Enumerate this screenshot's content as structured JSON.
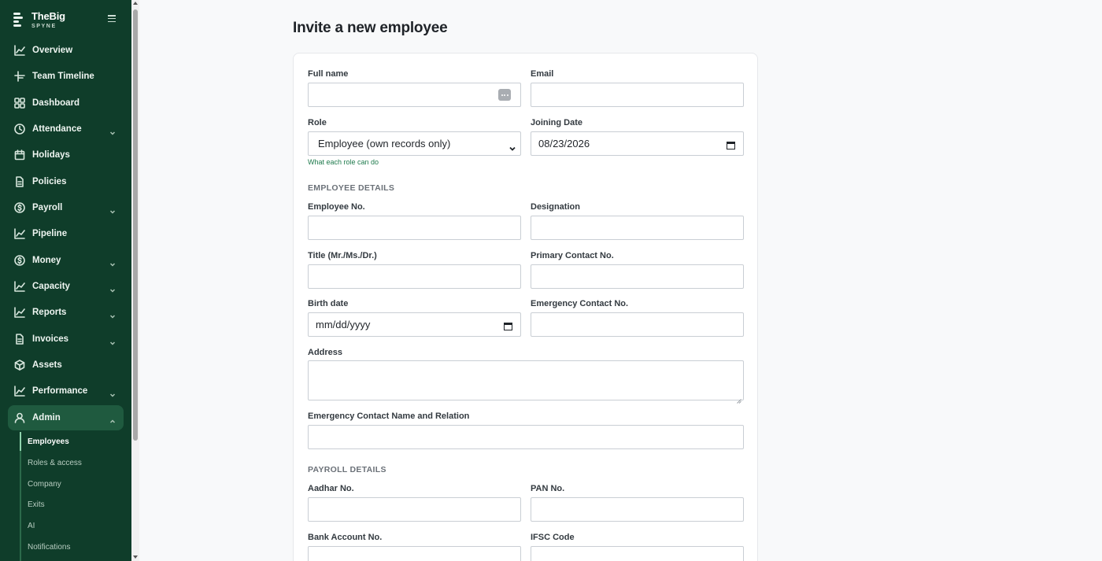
{
  "brand": {
    "name": "TheBig",
    "sub": "SPYNE"
  },
  "sidebar": {
    "items": [
      {
        "label": "Overview",
        "icon": "line-chart-icon",
        "has_chevron": false
      },
      {
        "label": "Team Timeline",
        "icon": "timeline-icon",
        "has_chevron": false
      },
      {
        "label": "Dashboard",
        "icon": "grid-icon",
        "has_chevron": false
      },
      {
        "label": "Attendance",
        "icon": "clock-icon",
        "has_chevron": true
      },
      {
        "label": "Holidays",
        "icon": "calendar-icon",
        "has_chevron": false
      },
      {
        "label": "Policies",
        "icon": "document-icon",
        "has_chevron": false
      },
      {
        "label": "Payroll",
        "icon": "dollar-circle-icon",
        "has_chevron": true
      },
      {
        "label": "Pipeline",
        "icon": "line-chart-icon",
        "has_chevron": false
      },
      {
        "label": "Money",
        "icon": "dollar-circle-icon",
        "has_chevron": true
      },
      {
        "label": "Capacity",
        "icon": "line-chart-icon",
        "has_chevron": true
      },
      {
        "label": "Reports",
        "icon": "line-chart-icon",
        "has_chevron": true
      },
      {
        "label": "Invoices",
        "icon": "document-icon",
        "has_chevron": true
      },
      {
        "label": "Assets",
        "icon": "box-icon",
        "has_chevron": false
      },
      {
        "label": "Performance",
        "icon": "line-chart-icon",
        "has_chevron": true
      },
      {
        "label": "Admin",
        "icon": "user-icon",
        "has_chevron": true,
        "active": true
      }
    ],
    "admin_subitems": [
      "Employees",
      "Roles & access",
      "Company",
      "Exits",
      "AI",
      "Notifications"
    ],
    "current_subitem": "Employees"
  },
  "page": {
    "title": "Invite a new employee"
  },
  "form": {
    "full_name_label": "Full name",
    "full_name_value": "",
    "email_label": "Email",
    "email_value": "",
    "role_label": "Role",
    "role_value": "Employee (own records only)",
    "role_help": "What each role can do",
    "joining_date_label": "Joining Date",
    "joining_date_value": "08/23/2026",
    "employee_details_heading": "EMPLOYEE DETAILS",
    "employee_no_label": "Employee No.",
    "designation_label": "Designation",
    "title_label": "Title (Mr./Ms./Dr.)",
    "primary_contact_label": "Primary Contact No.",
    "birth_date_label": "Birth date",
    "birth_date_placeholder": "mm/dd/yyyy",
    "emergency_contact_label": "Emergency Contact No.",
    "address_label": "Address",
    "emergency_name_label": "Emergency Contact Name and Relation",
    "payroll_details_heading": "PAYROLL DETAILS",
    "aadhar_label": "Aadhar No.",
    "pan_label": "PAN No.",
    "bank_account_label": "Bank Account No.",
    "ifsc_label": "IFSC Code"
  },
  "colors": {
    "sidebar_bg": "#0f3d2a",
    "sidebar_active": "#1f5a3f",
    "link": "#1e7a4c"
  }
}
